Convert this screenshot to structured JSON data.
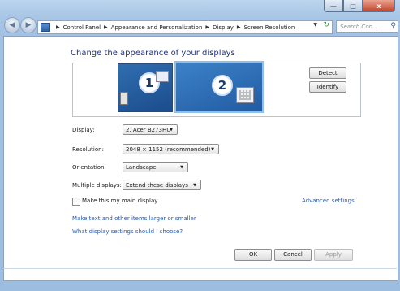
{
  "window": {
    "buttons": {
      "minimize": "—",
      "maximize": "□",
      "close": "x"
    }
  },
  "navigation": {
    "back_icon": "back-arrow-icon",
    "forward_icon": "forward-arrow-icon",
    "breadcrumbs": [
      "Control Panel",
      "Appearance and Personalization",
      "Display",
      "Screen Resolution"
    ],
    "search_placeholder": "Search Con...",
    "refresh_icon": "refresh-icon",
    "search_icon": "search-icon"
  },
  "main": {
    "heading": "Change the appearance of your displays",
    "preview": {
      "monitor_1": "1",
      "monitor_2": "2",
      "detect_label": "Detect",
      "identify_label": "Identify"
    },
    "fields": {
      "display_label": "Display:",
      "display_value": "2. Acer B273HU",
      "resolution_label": "Resolution:",
      "resolution_value": "2048 × 1152 (recommended)",
      "orientation_label": "Orientation:",
      "orientation_value": "Landscape",
      "multiple_label": "Multiple displays:",
      "multiple_value": "Extend these displays"
    },
    "main_display_checkbox": "Make this my main display",
    "advanced_settings": "Advanced settings",
    "link_text_size": "Make text and other items larger or smaller",
    "link_help": "What display settings should I choose?"
  },
  "footer_buttons": {
    "ok": "OK",
    "cancel": "Cancel",
    "apply": "Apply"
  },
  "colors": {
    "link": "#2359b5",
    "heading": "#1e3287",
    "frame": "#a9c6e6"
  }
}
